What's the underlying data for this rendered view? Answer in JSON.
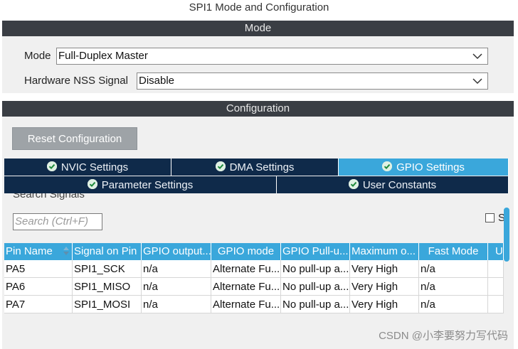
{
  "window": {
    "title": "SPI1 Mode and Configuration"
  },
  "mode_section": {
    "header": "Mode",
    "mode_label": "Mode",
    "mode_value": "Full-Duplex Master",
    "nss_label": "Hardware NSS Signal",
    "nss_value": "Disable"
  },
  "config_section": {
    "header": "Configuration",
    "reset_button": "Reset Configuration",
    "tabs_row1": [
      {
        "label": "NVIC Settings",
        "active": false
      },
      {
        "label": "DMA Settings",
        "active": false
      },
      {
        "label": "GPIO Settings",
        "active": true
      }
    ],
    "tabs_row2": [
      {
        "label": "Parameter Settings"
      },
      {
        "label": "User Constants"
      }
    ]
  },
  "search": {
    "label": "Search Signals",
    "placeholder": "Search (Ctrl+F)",
    "checkbox_label": "S"
  },
  "table": {
    "columns": [
      "Pin Name",
      "Signal on Pin",
      "GPIO output...",
      "GPIO mode",
      "GPIO Pull-u...",
      "Maximum o...",
      "Fast Mode",
      "U"
    ],
    "rows": [
      [
        "PA5",
        "SPI1_SCK",
        "n/a",
        "Alternate Fu...",
        "No pull-up a...",
        "Very High",
        "n/a",
        ""
      ],
      [
        "PA6",
        "SPI1_MISO",
        "n/a",
        "Alternate Fu...",
        "No pull-up a...",
        "Very High",
        "n/a",
        ""
      ],
      [
        "PA7",
        "SPI1_MOSI",
        "n/a",
        "Alternate Fu...",
        "No pull-up a...",
        "Very High",
        "n/a",
        ""
      ]
    ]
  },
  "watermark": "CSDN @小李要努力写代码",
  "colors": {
    "accent": "#3aa7db",
    "tab_dark": "#0f2a4a",
    "section_bar": "#3a3e44",
    "button_gray": "#9ea3a7"
  },
  "icons": {
    "tab_status": "check-circle-icon",
    "dropdown": "chevron-down-icon",
    "sort": "sort-arrow-icon"
  }
}
